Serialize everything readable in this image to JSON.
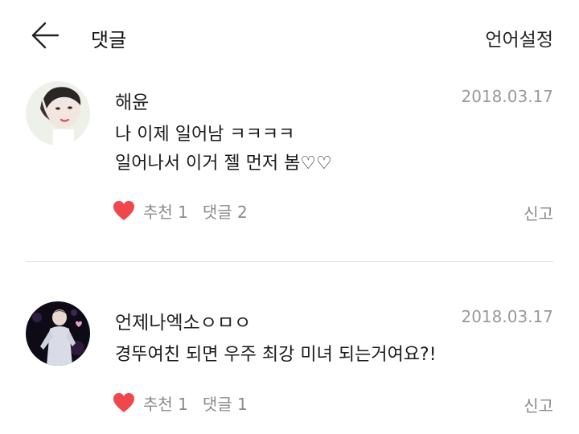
{
  "header": {
    "title": "댓글",
    "language_setting": "언어설정",
    "back_icon": "arrow-left-icon"
  },
  "comments": [
    {
      "author": "해윤",
      "date": "2018.03.17",
      "lines": [
        "나 이제 일어남 ㅋㅋㅋㅋ",
        "일어나서 이거 젤 먼저 봄♡♡"
      ],
      "like_label": "추천 1",
      "reply_label": "댓글 2",
      "report_label": "신고"
    },
    {
      "author": "언제나엑소ㅇㅁㅇ",
      "date": "2018.03.17",
      "lines": [
        "경뚜여친 되면 우주 최강 미녀 되는거여요?!"
      ],
      "like_label": "추천 1",
      "reply_label": "댓글 1",
      "report_label": "신고"
    }
  ],
  "colors": {
    "heart": "#f0474d",
    "muted_text": "#8a8a8a",
    "date_text": "#9a9a9a",
    "divider": "#e2e2e2"
  }
}
